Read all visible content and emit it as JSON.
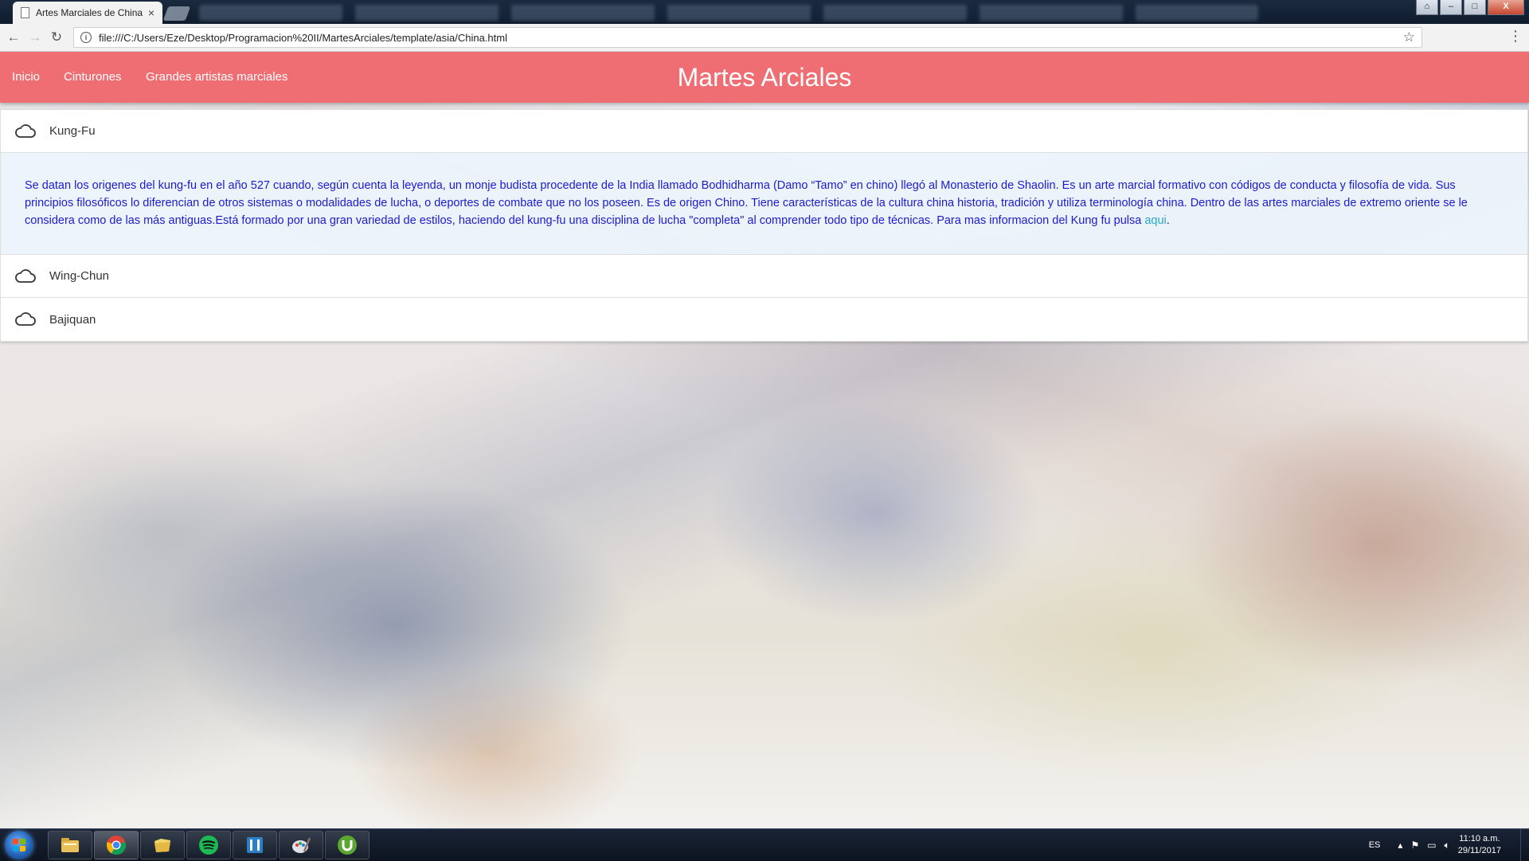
{
  "browser": {
    "tab_title": "Artes Marciales de China",
    "tab_close": "×",
    "url": "file:///C:/Users/Eze/Desktop/Programacion%20II/MartesArciales/template/asia/China.html",
    "back_icon": "←",
    "forward_icon": "→",
    "reload_icon": "↻",
    "star_icon": "☆",
    "menu_icon": "⋮",
    "info_icon": "i"
  },
  "window_controls": {
    "restore_tabs": "⌂",
    "minimize": "–",
    "maximize": "□",
    "close": "X"
  },
  "navbar": {
    "links": [
      "Inicio",
      "Cinturones",
      "Grandes artistas marciales"
    ],
    "brand": "Martes Arciales",
    "color": "#ee6e73"
  },
  "collapsible": {
    "items": [
      {
        "title": "Kung-Fu",
        "icon": "cloud-icon",
        "expanded": true,
        "body": "Se datan los origenes del kung-fu en el año 527 cuando, según cuenta la leyenda, un monje budista procedente de la India llamado Bodhidharma (Damo “Tamo” en chino) llegó al Monasterio de Shaolin. Es un arte marcial formativo con códigos de conducta y filosofía de vida. Sus principios filosóficos lo diferencian de otros sistemas o modalidades de lucha, o deportes de combate que no los poseen. Es de origen Chino. Tiene características de la cultura china historia, tradición y utiliza terminología china. Dentro de las artes marciales de extremo oriente se le considera como de las más antiguas.Está formado por una gran variedad de estilos, haciendo del kung-fu una disciplina de lucha \"completa\" al comprender todo tipo de técnicas. Para mas informacion del Kung fu pulsa ",
        "link_text": "aqui",
        "after_link": "."
      },
      {
        "title": "Wing-Chun",
        "icon": "cloud-icon",
        "expanded": false
      },
      {
        "title": "Bajiquan",
        "icon": "cloud-icon",
        "expanded": false
      }
    ],
    "body_text_color": "#1c1ccf",
    "link_color": "#26a6c9"
  },
  "taskbar": {
    "apps": [
      "start-button",
      "file-explorer-icon",
      "chrome-icon",
      "folder-icon",
      "spotify-icon",
      "app-icon",
      "paint-icon",
      "utorrent-icon"
    ],
    "tray": {
      "language": "ES",
      "time": "11:10 a.m.",
      "date": "29/11/2017"
    }
  }
}
